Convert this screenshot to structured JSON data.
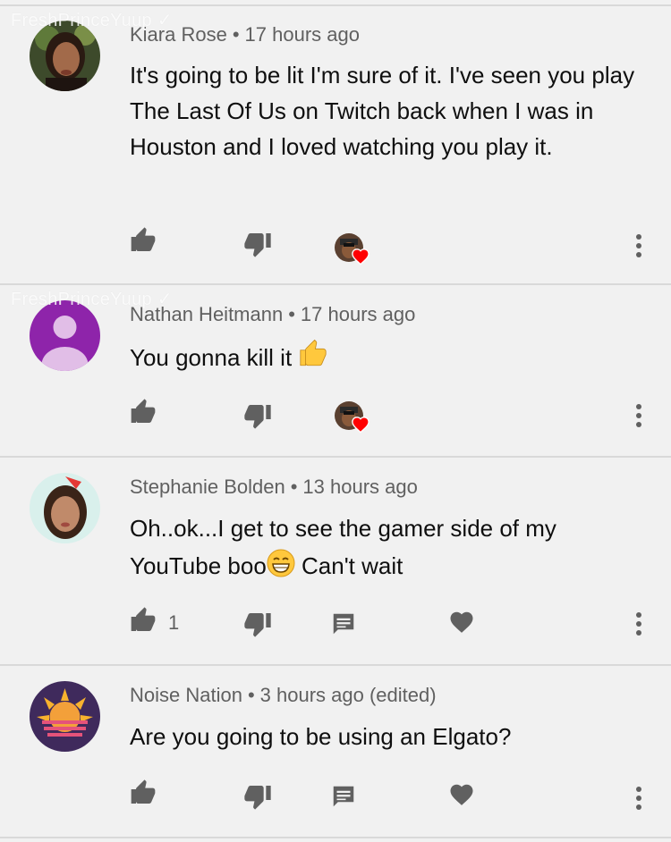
{
  "watermark": "FreshPrinceYuup ✓",
  "separator": "•",
  "comments": [
    {
      "author": "Kiara Rose",
      "time": "17 hours ago",
      "text": "It's going to be lit I'm sure of it. I've seen you play The Last Of Us on Twitch back when I was in Houston and I loved watching you play it.",
      "likes": "",
      "creator_hearted": true
    },
    {
      "author": "Nathan Heitmann",
      "time": "17 hours ago",
      "text": "You gonna kill it",
      "emoji": "thumbs-up-emoji",
      "likes": "",
      "creator_hearted": true
    },
    {
      "author": "Stephanie Bolden",
      "time": "13 hours ago",
      "text_line1": "Oh..ok...I get to see the gamer side of my",
      "text_line2a": "YouTube boo",
      "text_line2b": " Can't wait",
      "emoji": "grinning-emoji",
      "likes": "1",
      "creator_hearted": false
    },
    {
      "author": "Noise Nation",
      "time": "3 hours ago (edited)",
      "text": "Are you going to be using an Elgato?",
      "likes": "",
      "creator_hearted": false
    }
  ],
  "icons": {
    "like": "thumbs-up-icon",
    "dislike": "thumbs-down-icon",
    "reply": "reply-icon",
    "heart": "heart-icon",
    "more": "more-vert-icon"
  },
  "colors": {
    "background": "#f1f1f1",
    "icon": "#606060",
    "heart_red": "#ff0000",
    "divider": "#d9d9d9"
  }
}
